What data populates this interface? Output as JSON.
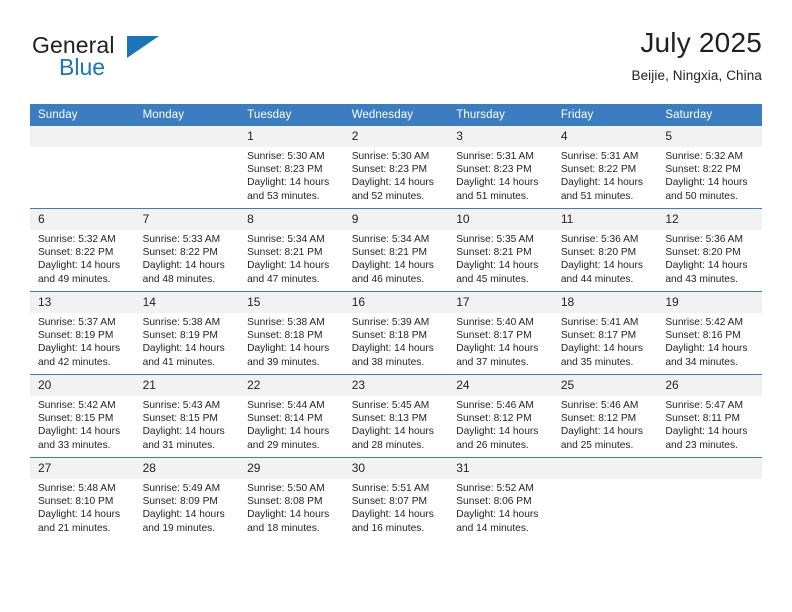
{
  "brand": {
    "name_top": "General",
    "name_bottom": "Blue",
    "accent_color": "#1b75bb"
  },
  "header": {
    "title": "July 2025",
    "subtitle": "Beijie, Ningxia, China"
  },
  "calendar": {
    "header_bg": "#3b7dc0",
    "daynum_bg": "#f2f2f2",
    "weekday_headers": [
      "Sunday",
      "Monday",
      "Tuesday",
      "Wednesday",
      "Thursday",
      "Friday",
      "Saturday"
    ],
    "weeks": [
      [
        {
          "day": "",
          "empty": true,
          "lines": []
        },
        {
          "day": "",
          "empty": true,
          "lines": []
        },
        {
          "day": "1",
          "lines": [
            "Sunrise: 5:30 AM",
            "Sunset: 8:23 PM",
            "Daylight: 14 hours",
            "and 53 minutes."
          ]
        },
        {
          "day": "2",
          "lines": [
            "Sunrise: 5:30 AM",
            "Sunset: 8:23 PM",
            "Daylight: 14 hours",
            "and 52 minutes."
          ]
        },
        {
          "day": "3",
          "lines": [
            "Sunrise: 5:31 AM",
            "Sunset: 8:23 PM",
            "Daylight: 14 hours",
            "and 51 minutes."
          ]
        },
        {
          "day": "4",
          "lines": [
            "Sunrise: 5:31 AM",
            "Sunset: 8:22 PM",
            "Daylight: 14 hours",
            "and 51 minutes."
          ]
        },
        {
          "day": "5",
          "lines": [
            "Sunrise: 5:32 AM",
            "Sunset: 8:22 PM",
            "Daylight: 14 hours",
            "and 50 minutes."
          ]
        }
      ],
      [
        {
          "day": "6",
          "lines": [
            "Sunrise: 5:32 AM",
            "Sunset: 8:22 PM",
            "Daylight: 14 hours",
            "and 49 minutes."
          ]
        },
        {
          "day": "7",
          "lines": [
            "Sunrise: 5:33 AM",
            "Sunset: 8:22 PM",
            "Daylight: 14 hours",
            "and 48 minutes."
          ]
        },
        {
          "day": "8",
          "lines": [
            "Sunrise: 5:34 AM",
            "Sunset: 8:21 PM",
            "Daylight: 14 hours",
            "and 47 minutes."
          ]
        },
        {
          "day": "9",
          "lines": [
            "Sunrise: 5:34 AM",
            "Sunset: 8:21 PM",
            "Daylight: 14 hours",
            "and 46 minutes."
          ]
        },
        {
          "day": "10",
          "lines": [
            "Sunrise: 5:35 AM",
            "Sunset: 8:21 PM",
            "Daylight: 14 hours",
            "and 45 minutes."
          ]
        },
        {
          "day": "11",
          "lines": [
            "Sunrise: 5:36 AM",
            "Sunset: 8:20 PM",
            "Daylight: 14 hours",
            "and 44 minutes."
          ]
        },
        {
          "day": "12",
          "lines": [
            "Sunrise: 5:36 AM",
            "Sunset: 8:20 PM",
            "Daylight: 14 hours",
            "and 43 minutes."
          ]
        }
      ],
      [
        {
          "day": "13",
          "lines": [
            "Sunrise: 5:37 AM",
            "Sunset: 8:19 PM",
            "Daylight: 14 hours",
            "and 42 minutes."
          ]
        },
        {
          "day": "14",
          "lines": [
            "Sunrise: 5:38 AM",
            "Sunset: 8:19 PM",
            "Daylight: 14 hours",
            "and 41 minutes."
          ]
        },
        {
          "day": "15",
          "lines": [
            "Sunrise: 5:38 AM",
            "Sunset: 8:18 PM",
            "Daylight: 14 hours",
            "and 39 minutes."
          ]
        },
        {
          "day": "16",
          "lines": [
            "Sunrise: 5:39 AM",
            "Sunset: 8:18 PM",
            "Daylight: 14 hours",
            "and 38 minutes."
          ]
        },
        {
          "day": "17",
          "lines": [
            "Sunrise: 5:40 AM",
            "Sunset: 8:17 PM",
            "Daylight: 14 hours",
            "and 37 minutes."
          ]
        },
        {
          "day": "18",
          "lines": [
            "Sunrise: 5:41 AM",
            "Sunset: 8:17 PM",
            "Daylight: 14 hours",
            "and 35 minutes."
          ]
        },
        {
          "day": "19",
          "lines": [
            "Sunrise: 5:42 AM",
            "Sunset: 8:16 PM",
            "Daylight: 14 hours",
            "and 34 minutes."
          ]
        }
      ],
      [
        {
          "day": "20",
          "lines": [
            "Sunrise: 5:42 AM",
            "Sunset: 8:15 PM",
            "Daylight: 14 hours",
            "and 33 minutes."
          ]
        },
        {
          "day": "21",
          "lines": [
            "Sunrise: 5:43 AM",
            "Sunset: 8:15 PM",
            "Daylight: 14 hours",
            "and 31 minutes."
          ]
        },
        {
          "day": "22",
          "lines": [
            "Sunrise: 5:44 AM",
            "Sunset: 8:14 PM",
            "Daylight: 14 hours",
            "and 29 minutes."
          ]
        },
        {
          "day": "23",
          "lines": [
            "Sunrise: 5:45 AM",
            "Sunset: 8:13 PM",
            "Daylight: 14 hours",
            "and 28 minutes."
          ]
        },
        {
          "day": "24",
          "lines": [
            "Sunrise: 5:46 AM",
            "Sunset: 8:12 PM",
            "Daylight: 14 hours",
            "and 26 minutes."
          ]
        },
        {
          "day": "25",
          "lines": [
            "Sunrise: 5:46 AM",
            "Sunset: 8:12 PM",
            "Daylight: 14 hours",
            "and 25 minutes."
          ]
        },
        {
          "day": "26",
          "lines": [
            "Sunrise: 5:47 AM",
            "Sunset: 8:11 PM",
            "Daylight: 14 hours",
            "and 23 minutes."
          ]
        }
      ],
      [
        {
          "day": "27",
          "lines": [
            "Sunrise: 5:48 AM",
            "Sunset: 8:10 PM",
            "Daylight: 14 hours",
            "and 21 minutes."
          ]
        },
        {
          "day": "28",
          "lines": [
            "Sunrise: 5:49 AM",
            "Sunset: 8:09 PM",
            "Daylight: 14 hours",
            "and 19 minutes."
          ]
        },
        {
          "day": "29",
          "lines": [
            "Sunrise: 5:50 AM",
            "Sunset: 8:08 PM",
            "Daylight: 14 hours",
            "and 18 minutes."
          ]
        },
        {
          "day": "30",
          "lines": [
            "Sunrise: 5:51 AM",
            "Sunset: 8:07 PM",
            "Daylight: 14 hours",
            "and 16 minutes."
          ]
        },
        {
          "day": "31",
          "lines": [
            "Sunrise: 5:52 AM",
            "Sunset: 8:06 PM",
            "Daylight: 14 hours",
            "and 14 minutes."
          ]
        },
        {
          "day": "",
          "empty": true,
          "lines": []
        },
        {
          "day": "",
          "empty": true,
          "lines": []
        }
      ]
    ]
  }
}
